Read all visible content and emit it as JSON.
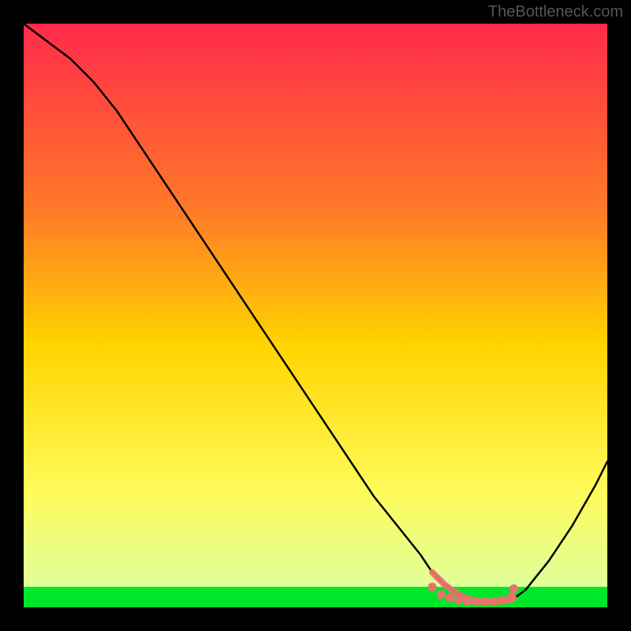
{
  "watermark": "TheBottleneck.com",
  "colors": {
    "background": "#000000",
    "curve": "#000000",
    "marker_fill": "#e8736c",
    "bottom_highlight": "#00e62b",
    "gradient_top": "#ff2a4b",
    "gradient_mid1": "#ff7a27",
    "gradient_mid2": "#ffd400",
    "gradient_mid3": "#fffb5a",
    "gradient_bottom": "#dfff9a"
  },
  "chart_data": {
    "type": "line",
    "title": "",
    "xlabel": "",
    "ylabel": "",
    "xlim": [
      0,
      100
    ],
    "ylim": [
      0,
      100
    ],
    "x": [
      0,
      4,
      8,
      12,
      16,
      20,
      24,
      28,
      32,
      36,
      40,
      44,
      48,
      52,
      56,
      60,
      64,
      68,
      70,
      72,
      74,
      76,
      78,
      80,
      82,
      84,
      86,
      90,
      94,
      98,
      100
    ],
    "y": [
      100,
      97,
      94,
      90,
      85,
      79,
      73,
      67,
      61,
      55,
      49,
      43,
      37,
      31,
      25,
      19,
      14,
      9,
      6,
      4,
      2.5,
      1.5,
      1,
      1,
      1,
      1.5,
      3,
      8,
      14,
      21,
      25
    ],
    "flat_region_x": [
      70,
      84
    ],
    "flat_region_y": 1,
    "markers_x": [
      70,
      71.5,
      73,
      74.5,
      76,
      77.5,
      79,
      80.5,
      82,
      83.5,
      84
    ],
    "markers_y": [
      3.5,
      2.2,
      1.6,
      1.2,
      1.0,
      1.0,
      1.0,
      1.0,
      1.2,
      1.8,
      3.2
    ]
  }
}
